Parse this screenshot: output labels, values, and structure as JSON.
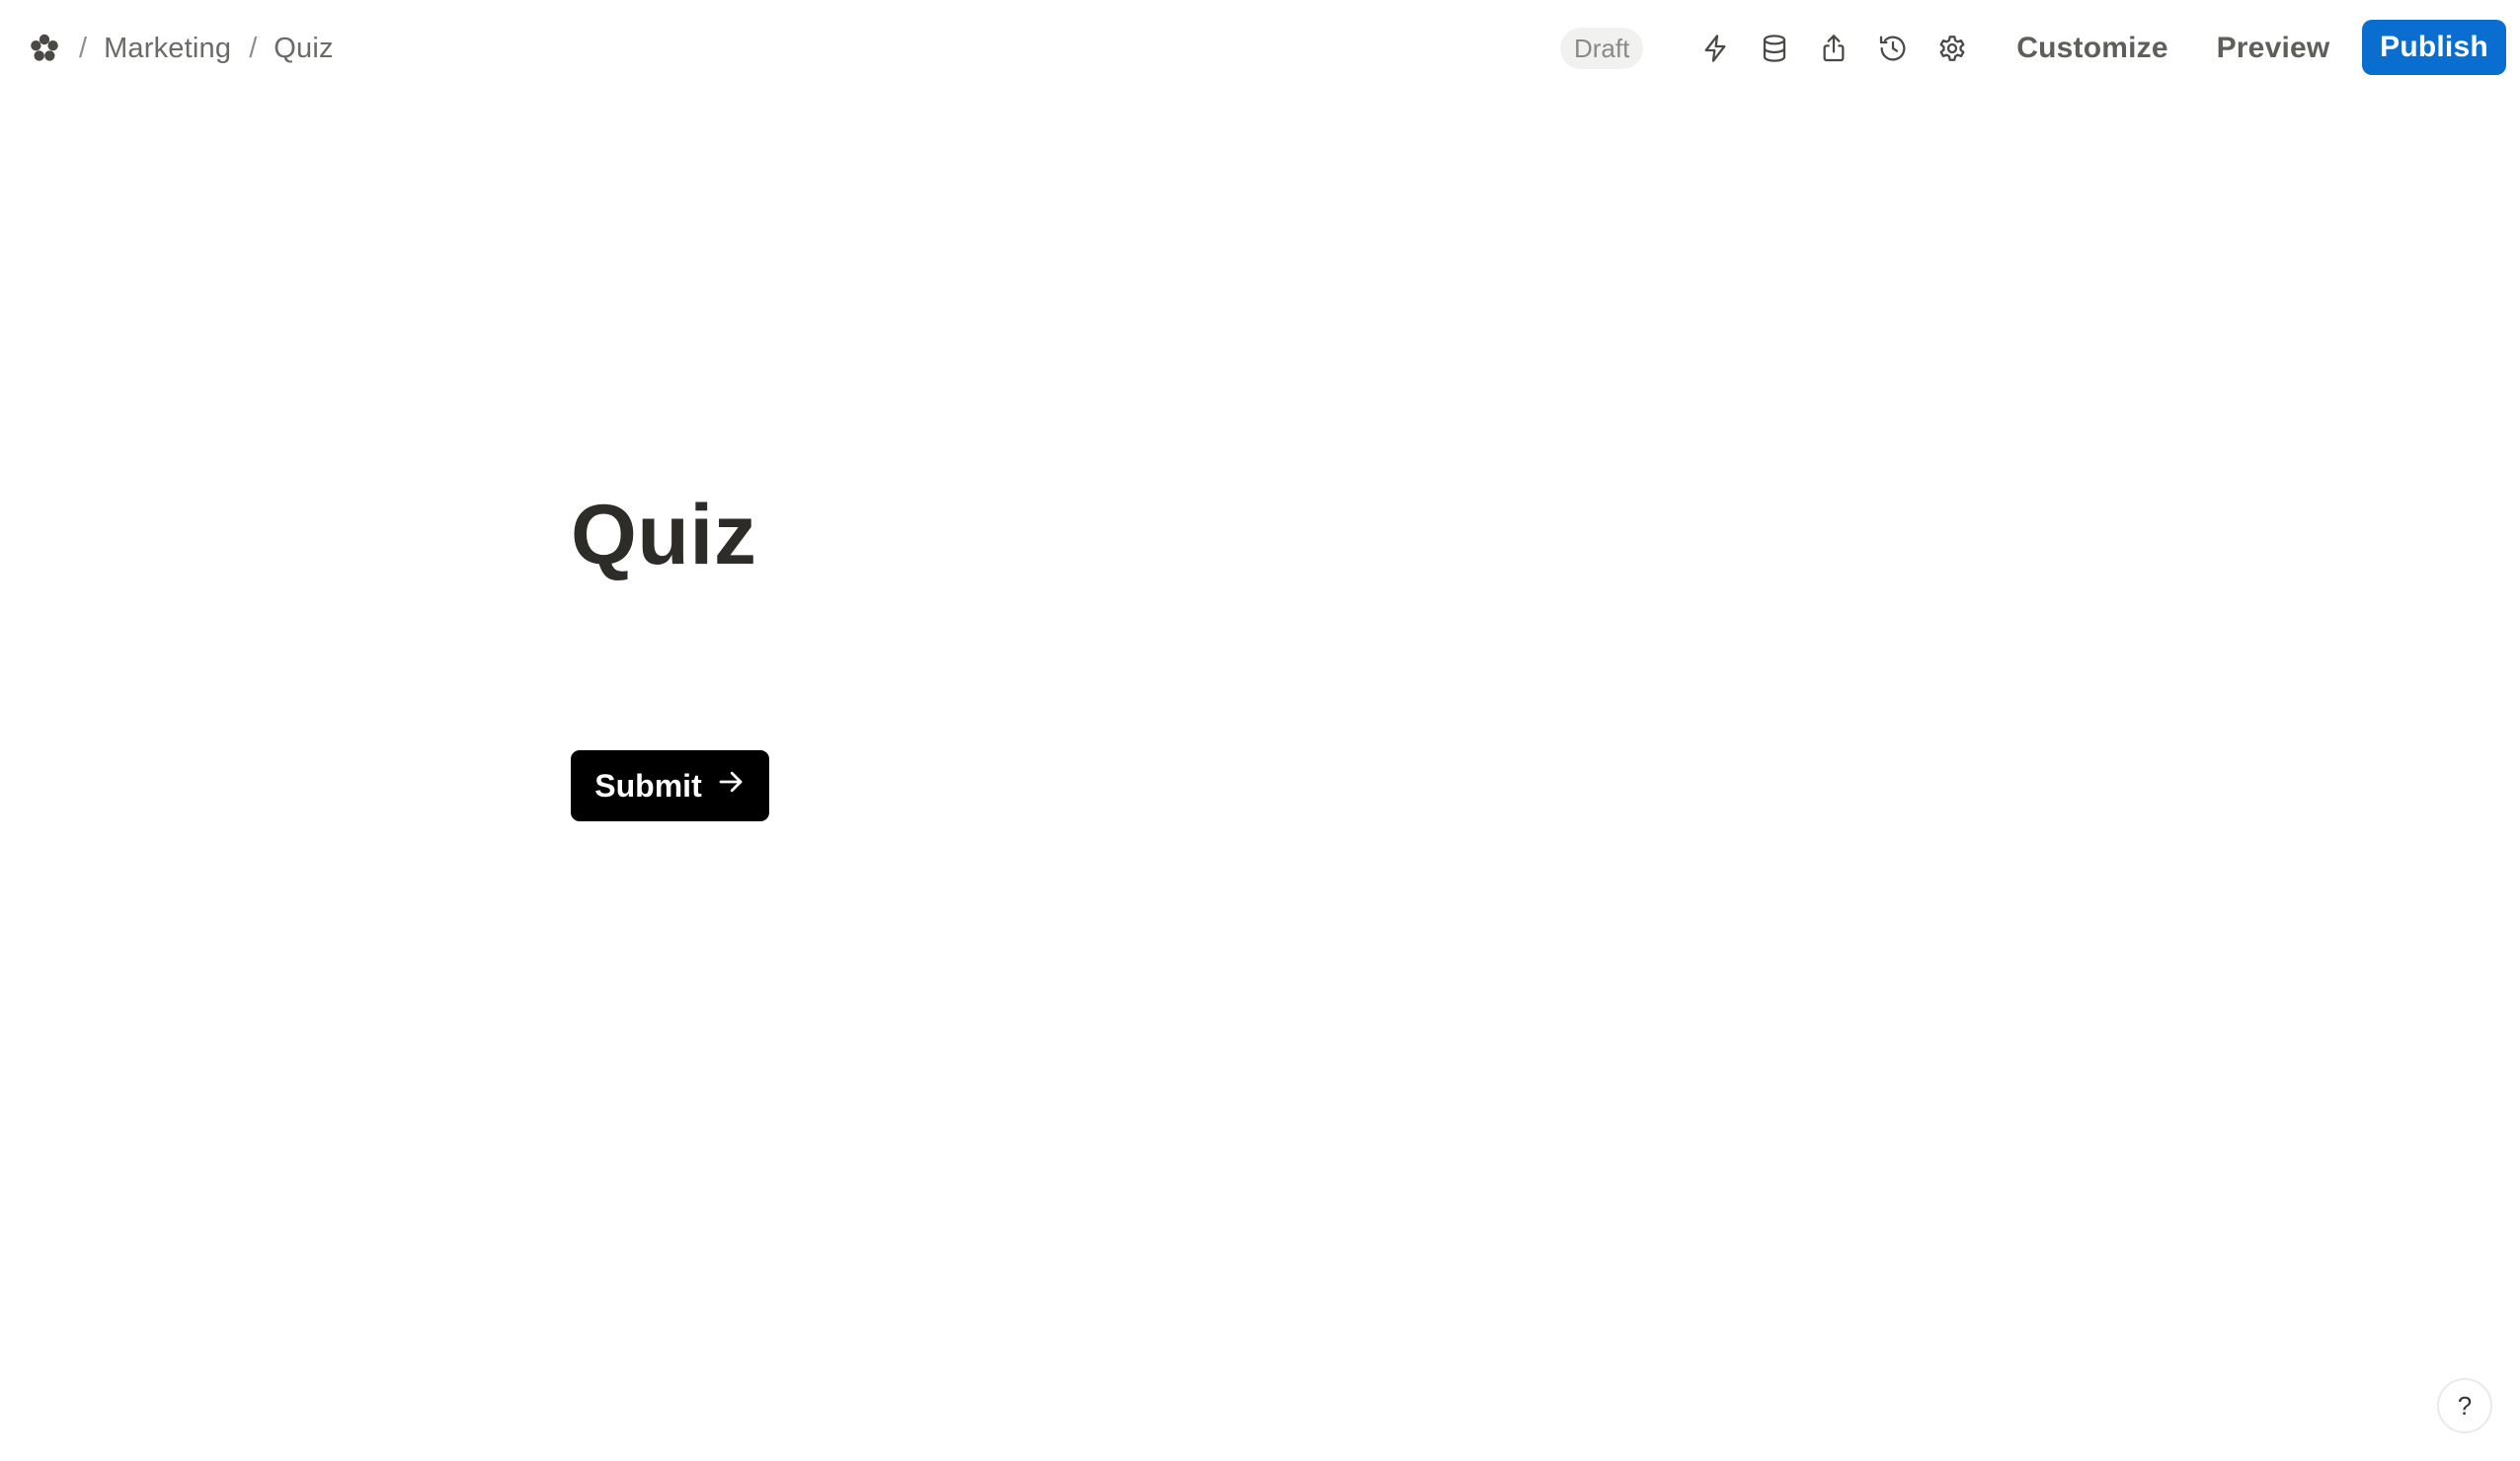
{
  "breadcrumb": {
    "logo_icon": "flower-logo-icon",
    "separator": "/",
    "workspace": "Marketing",
    "page": "Quiz"
  },
  "toolbar": {
    "status": "Draft",
    "icons": [
      "lightning-icon",
      "database-icon",
      "share-icon",
      "history-icon",
      "gear-icon"
    ],
    "customize_label": "Customize",
    "preview_label": "Preview",
    "publish_label": "Publish",
    "publish_color": "#0a6ed1"
  },
  "form": {
    "title": "Quiz",
    "submit_label": "Submit",
    "submit_icon": "arrow-right-icon"
  },
  "help": {
    "label": "?"
  }
}
